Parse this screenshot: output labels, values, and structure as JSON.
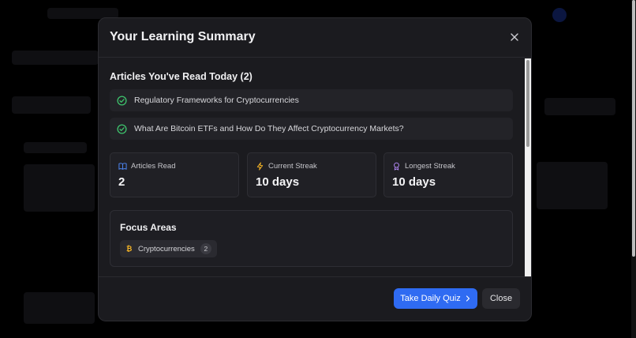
{
  "modal": {
    "title": "Your Learning Summary",
    "articles_heading": "Articles You've Read Today (2)",
    "articles": [
      "Regulatory Frameworks for Cryptocurrencies",
      "What Are Bitcoin ETFs and How Do They Affect Cryptocurrency Markets?"
    ],
    "stats": [
      {
        "icon": "book-icon",
        "label": "Articles Read",
        "value": "2",
        "color": "#4f8cff"
      },
      {
        "icon": "lightning-icon",
        "label": "Current Streak",
        "value": "10 days",
        "color": "#f5b425"
      },
      {
        "icon": "award-icon",
        "label": "Longest Streak",
        "value": "10 days",
        "color": "#b98cff"
      }
    ],
    "focus": {
      "title": "Focus Areas",
      "chips": [
        {
          "label": "Cryptocurrencies",
          "count": "2",
          "symbol": "₿"
        }
      ]
    },
    "buttons": {
      "quiz": "Take Daily Quiz",
      "close": "Close"
    }
  },
  "colors": {
    "accent": "#2f6bf2",
    "success": "#3ec46d"
  }
}
